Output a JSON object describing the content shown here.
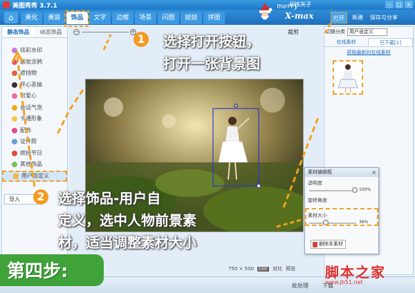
{
  "app": {
    "title": "美图秀秀 3.7.1",
    "user": "胡桃夹子",
    "window_controls": [
      "–",
      "□",
      "×"
    ]
  },
  "toolbar": {
    "home": "⌂",
    "tabs": [
      "美化",
      "美容",
      "饰品",
      "文字",
      "边框",
      "场景",
      "闪图",
      "娃娃",
      "拼图"
    ],
    "active_tab": "饰品",
    "open": "打开",
    "new": "新建",
    "save": "保存与分享"
  },
  "decor": {
    "merry": "merry",
    "xmax": "X-max"
  },
  "sidebar": {
    "tabs": [
      "静态饰品",
      "动态饰品"
    ],
    "items": [
      "炫彩水印",
      "靓妆涂鸦",
      "遮挡物",
      "开心恶搞",
      "可爱心",
      "会话气泡",
      "卡通形象",
      "配饰",
      "证件照",
      "缤纷节日",
      "其他饰品",
      "用户自定义"
    ],
    "import_button": "导入"
  },
  "canvas": {
    "crop_label": "裁剪",
    "size": "750 × 500",
    "exif": "EXIF",
    "compare": "对比",
    "preview": "预览"
  },
  "right_panel": {
    "category_label": "切换分类",
    "category_value": "用户自定义",
    "tabs": [
      "在线素材",
      "已下载[1]"
    ],
    "latest_link": "获取最新的在线素材"
  },
  "editor": {
    "title": "素材编辑框",
    "close": "×",
    "opacity_label": "透明度",
    "opacity_value": "100%",
    "rotation_label": "旋转角度",
    "size_label": "素材大小",
    "size_value": "36%",
    "delete_button": "删除本素材"
  },
  "statusbar": {
    "batch": "批处理",
    "download": "下载"
  },
  "annotations": {
    "step1_num": "1",
    "step1_line1": "选择打开按钮，",
    "step1_line2": "打开一张背景图",
    "step2_num": "2",
    "step2_line1": "选择饰品-用户自",
    "step2_line2": "定义，选中人物前景素",
    "step2_line3": "材，适当调整素材大小",
    "step_label": "第四步:",
    "logo": "脚本之家",
    "logo_url": "www.jb51.net"
  },
  "colors": {
    "accent": "#1f6fbd",
    "highlight": "#f5a020",
    "step": "#3fa33a",
    "logo": "#e03030"
  }
}
